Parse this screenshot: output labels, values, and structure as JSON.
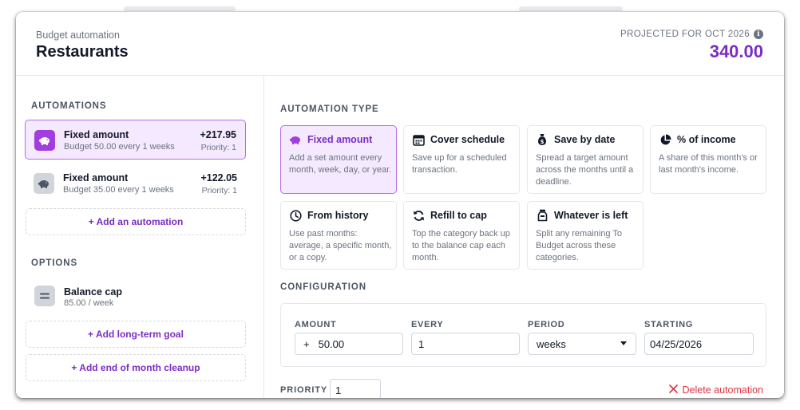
{
  "header": {
    "kicker": "Budget automation",
    "title": "Restaurants",
    "projected_label": "PROJECTED FOR OCT 2026",
    "projected_value": "340.00"
  },
  "left": {
    "automations_label": "AUTOMATIONS",
    "automations": [
      {
        "name": "Fixed amount",
        "desc": "Budget 50.00 every 1 weeks",
        "amount": "+217.95",
        "priority": "Priority: 1",
        "icon": "piggy-bank-icon",
        "selected": true
      },
      {
        "name": "Fixed amount",
        "desc": "Budget 35.00 every 1 weeks",
        "amount": "+122.05",
        "priority": "Priority: 1",
        "icon": "piggy-bank-icon",
        "selected": false
      }
    ],
    "add_automation": "+ Add an automation",
    "options_label": "OPTIONS",
    "options": [
      {
        "name": "Balance cap",
        "desc": "85.00 / week",
        "icon": "equals-icon"
      }
    ],
    "add_long_term_goal": "+ Add long-term goal",
    "add_cleanup": "+ Add end of month cleanup"
  },
  "right": {
    "type_label": "AUTOMATION TYPE",
    "types": [
      {
        "name": "Fixed amount",
        "desc": "Add a set amount every month, week, day, or year.",
        "icon": "piggy-bank-icon",
        "selected": true
      },
      {
        "name": "Cover schedule",
        "desc": "Save up for a scheduled transaction.",
        "icon": "calendar-icon",
        "selected": false
      },
      {
        "name": "Save by date",
        "desc": "Spread a target amount across the months until a deadline.",
        "icon": "money-bag-icon",
        "selected": false
      },
      {
        "name": "% of income",
        "desc": "A share of this month's or last month's income.",
        "icon": "pie-chart-icon",
        "selected": false
      },
      {
        "name": "From history",
        "desc": "Use past months: average, a specific month, or a copy.",
        "icon": "clock-icon",
        "selected": false
      },
      {
        "name": "Refill to cap",
        "desc": "Top the category back up to the balance cap each month.",
        "icon": "refresh-icon",
        "selected": false
      },
      {
        "name": "Whatever is left",
        "desc": "Split any remaining To Budget across these categories.",
        "icon": "jar-icon",
        "selected": false
      }
    ],
    "config_label": "CONFIGURATION",
    "config": {
      "amount_label": "AMOUNT",
      "amount_prefix": "+",
      "amount_value": "50.00",
      "every_label": "EVERY",
      "every_value": "1",
      "period_label": "PERIOD",
      "period_value": "weeks",
      "starting_label": "STARTING",
      "starting_value": "04/25/2026"
    },
    "priority_label": "PRIORITY",
    "priority_value": "1",
    "delete_label": "Delete automation"
  },
  "colors": {
    "accent": "#7c2cc4",
    "selected_bg": "#f5e9ff",
    "selected_border": "#b56de6",
    "danger": "#dc3545"
  }
}
